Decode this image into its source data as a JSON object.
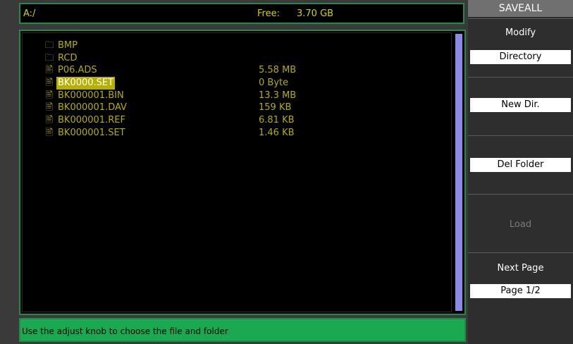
{
  "path_bar": {
    "path": "A:/",
    "free_label": "Free:",
    "free_value": "3.70 GB"
  },
  "files": [
    {
      "icon": "folder-icon",
      "name": "BMP",
      "size": ""
    },
    {
      "icon": "folder-icon",
      "name": "RCD",
      "size": ""
    },
    {
      "icon": "file-icon",
      "name": "P06.ADS",
      "size": "5.58 MB"
    },
    {
      "icon": "file-icon",
      "name": "BK0000.SET",
      "size": "0 Byte",
      "selected": true
    },
    {
      "icon": "file-icon",
      "name": "BK000001.BIN",
      "size": "13.3 MB"
    },
    {
      "icon": "file-icon",
      "name": "BK000001.DAV",
      "size": "159 KB"
    },
    {
      "icon": "file-icon",
      "name": "BK000001.REF",
      "size": "6.81 KB"
    },
    {
      "icon": "file-icon",
      "name": "BK000001.SET",
      "size": "1.46 KB"
    }
  ],
  "status": {
    "message": "Use the adjust knob to choose the file and folder"
  },
  "menu": {
    "title": "SAVEALL",
    "modify_label": "Modify",
    "modify_value": "Directory",
    "new_dir_label": "New Dir.",
    "del_folder_label": "Del Folder",
    "load_label": "Load",
    "next_page_label": "Next Page",
    "page_value": "Page 1/2"
  },
  "colors": {
    "file_text": "#b4ae00",
    "highlight": "#b8b000",
    "status_bg": "#1aa850",
    "scroll_thumb": "#8a8ae8"
  }
}
